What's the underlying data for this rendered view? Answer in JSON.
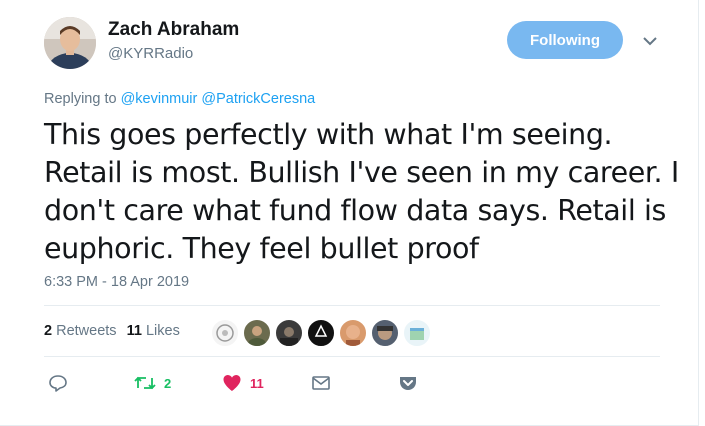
{
  "user": {
    "name": "Zach Abraham",
    "handle": "@KYRRadio",
    "follow_label": "Following"
  },
  "reply": {
    "prefix": "Replying to",
    "mentions": [
      "@kevinmuir",
      "@PatrickCeresna"
    ]
  },
  "tweet": {
    "text": "This goes perfectly with what I'm seeing. Retail is most. Bullish I've seen in my career. I don't care what fund flow data says. Retail is euphoric. They feel bullet proof",
    "timestamp": "6:33 PM - 18 Apr 2019"
  },
  "stats": {
    "retweets_count": "2",
    "retweets_label": "Retweets",
    "likes_count": "11",
    "likes_label": "Likes"
  },
  "actions": {
    "retweet_count": "2",
    "like_count": "11"
  },
  "colors": {
    "accent": "#1da1f2",
    "follow_button": "#79b8f0",
    "retweet": "#17bf63",
    "like": "#e0245e",
    "muted": "#657786"
  },
  "icons": [
    "chevron-down-icon",
    "reply-icon",
    "retweet-icon",
    "heart-icon",
    "envelope-icon",
    "pocket-icon"
  ]
}
